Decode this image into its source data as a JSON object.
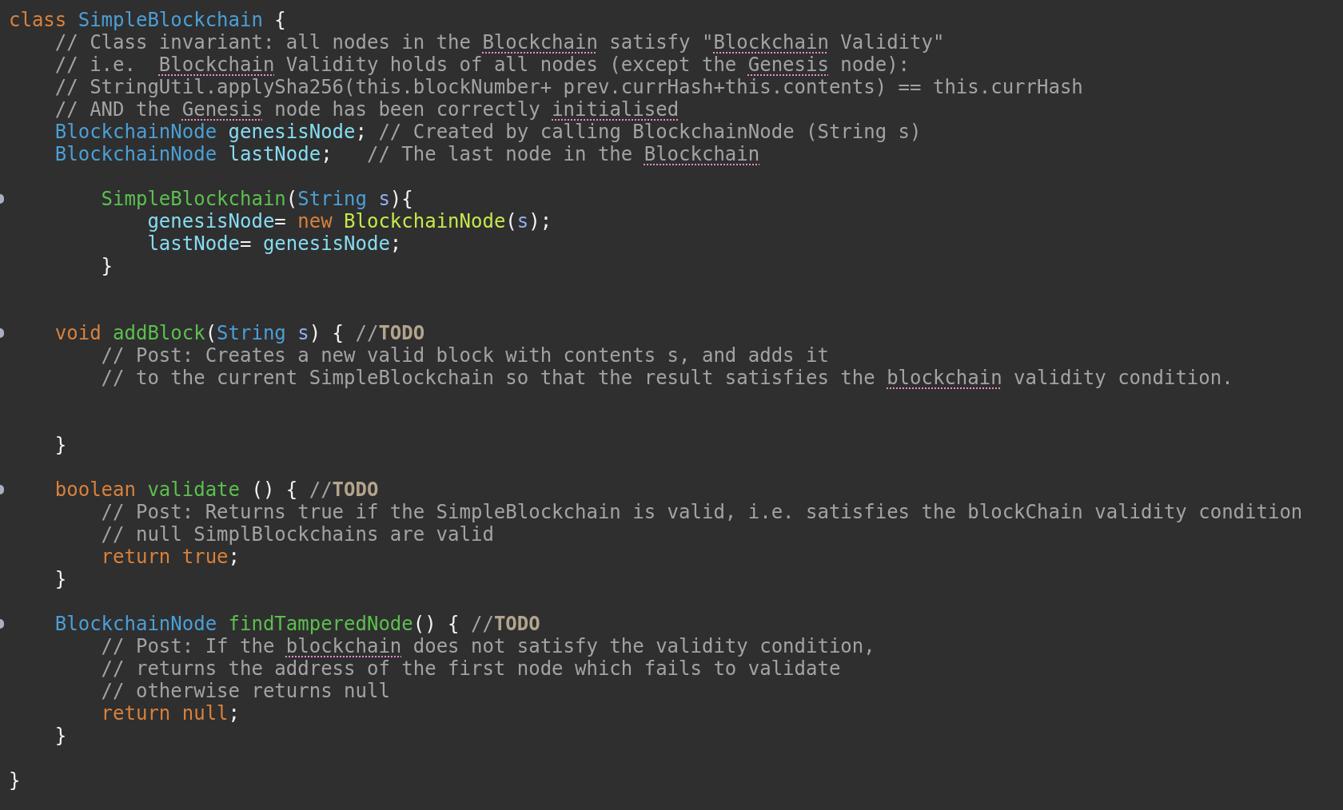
{
  "editor": {
    "lines": [
      {
        "fold": false,
        "tokens": [
          {
            "text": "class ",
            "kind": "keyword"
          },
          {
            "text": "SimpleBlockchain",
            "kind": "type"
          },
          {
            "text": " {",
            "kind": "plain"
          }
        ]
      },
      {
        "fold": false,
        "tokens": [
          {
            "text": "    // Class invariant: all nodes in the ",
            "kind": "comment"
          },
          {
            "text": "Blockchain",
            "kind": "flagged"
          },
          {
            "text": " satisfy \"",
            "kind": "comment"
          },
          {
            "text": "Blockchain",
            "kind": "flagged"
          },
          {
            "text": " Validity\"",
            "kind": "comment"
          }
        ]
      },
      {
        "fold": false,
        "tokens": [
          {
            "text": "    // i.e.  ",
            "kind": "comment"
          },
          {
            "text": "Blockchain",
            "kind": "flagged"
          },
          {
            "text": " Validity holds of all nodes (except the ",
            "kind": "comment"
          },
          {
            "text": "Genesis",
            "kind": "flagged"
          },
          {
            "text": " node):",
            "kind": "comment"
          }
        ]
      },
      {
        "fold": false,
        "tokens": [
          {
            "text": "    // StringUtil.applySha256(this.blockNumber+ prev.currHash+this.contents) == this.currHash",
            "kind": "comment"
          }
        ]
      },
      {
        "fold": false,
        "tokens": [
          {
            "text": "    // AND the ",
            "kind": "comment"
          },
          {
            "text": "Genesis",
            "kind": "flagged"
          },
          {
            "text": " node has been correctly ",
            "kind": "comment"
          },
          {
            "text": "initialised",
            "kind": "flagged"
          }
        ]
      },
      {
        "fold": false,
        "tokens": [
          {
            "text": "    BlockchainNode ",
            "kind": "type"
          },
          {
            "text": "genesisNode",
            "kind": "field"
          },
          {
            "text": "; ",
            "kind": "plain"
          },
          {
            "text": "// Created by calling BlockchainNode (String s)",
            "kind": "comment"
          }
        ]
      },
      {
        "fold": false,
        "tokens": [
          {
            "text": "    BlockchainNode ",
            "kind": "type"
          },
          {
            "text": "lastNode",
            "kind": "field"
          },
          {
            "text": ";   ",
            "kind": "plain"
          },
          {
            "text": "// The last node in the ",
            "kind": "comment"
          },
          {
            "text": "Blockchain",
            "kind": "flagged"
          }
        ]
      },
      {
        "fold": false
      },
      {
        "fold": true,
        "tokens": [
          {
            "text": "        SimpleBlockchain",
            "kind": "func"
          },
          {
            "text": "(",
            "kind": "plain"
          },
          {
            "text": "String ",
            "kind": "type"
          },
          {
            "text": "s",
            "kind": "param"
          },
          {
            "text": "){",
            "kind": "plain"
          }
        ]
      },
      {
        "fold": false,
        "tokens": [
          {
            "text": "            genesisNode",
            "kind": "field"
          },
          {
            "text": "= ",
            "kind": "plain"
          },
          {
            "text": "new ",
            "kind": "keyword"
          },
          {
            "text": "BlockchainNode",
            "kind": "call"
          },
          {
            "text": "(",
            "kind": "plain"
          },
          {
            "text": "s",
            "kind": "param"
          },
          {
            "text": ");",
            "kind": "plain"
          }
        ]
      },
      {
        "fold": false,
        "tokens": [
          {
            "text": "            lastNode",
            "kind": "field"
          },
          {
            "text": "= ",
            "kind": "plain"
          },
          {
            "text": "genesisNode",
            "kind": "field"
          },
          {
            "text": ";",
            "kind": "plain"
          }
        ]
      },
      {
        "fold": false,
        "tokens": [
          {
            "text": "        }",
            "kind": "plain"
          }
        ]
      },
      {
        "fold": false
      },
      {
        "fold": false
      },
      {
        "fold": true,
        "tokens": [
          {
            "text": "    void ",
            "kind": "keyword"
          },
          {
            "text": "addBlock",
            "kind": "func"
          },
          {
            "text": "(",
            "kind": "plain"
          },
          {
            "text": "String ",
            "kind": "type"
          },
          {
            "text": "s",
            "kind": "param"
          },
          {
            "text": ") { ",
            "kind": "plain"
          },
          {
            "text": "//",
            "kind": "comment"
          },
          {
            "text": "TODO",
            "kind": "todo"
          }
        ]
      },
      {
        "fold": false,
        "tokens": [
          {
            "text": "        // Post: Creates a new valid block with contents s, and adds it",
            "kind": "comment"
          }
        ]
      },
      {
        "fold": false,
        "tokens": [
          {
            "text": "        // to the current SimpleBlockchain so that the result satisfies the ",
            "kind": "comment"
          },
          {
            "text": "blockchain",
            "kind": "flagged"
          },
          {
            "text": " validity condition.",
            "kind": "comment"
          }
        ]
      },
      {
        "fold": false
      },
      {
        "fold": false
      },
      {
        "fold": false,
        "tokens": [
          {
            "text": "    }",
            "kind": "plain"
          }
        ]
      },
      {
        "fold": false
      },
      {
        "fold": true,
        "tokens": [
          {
            "text": "    boolean ",
            "kind": "keyword"
          },
          {
            "text": "validate ",
            "kind": "func"
          },
          {
            "text": "() { ",
            "kind": "plain"
          },
          {
            "text": "//",
            "kind": "comment"
          },
          {
            "text": "TODO",
            "kind": "todo"
          }
        ]
      },
      {
        "fold": false,
        "tokens": [
          {
            "text": "        // Post: Returns true if the SimpleBlockchain is valid, i.e. satisfies the blockChain validity condition",
            "kind": "comment"
          }
        ]
      },
      {
        "fold": false,
        "tokens": [
          {
            "text": "        // null SimplBlockchains are valid",
            "kind": "comment"
          }
        ]
      },
      {
        "fold": false,
        "tokens": [
          {
            "text": "        return true",
            "kind": "keyword"
          },
          {
            "text": ";",
            "kind": "plain"
          }
        ]
      },
      {
        "fold": false,
        "tokens": [
          {
            "text": "    }",
            "kind": "plain"
          }
        ]
      },
      {
        "fold": false
      },
      {
        "fold": true,
        "tokens": [
          {
            "text": "    BlockchainNode ",
            "kind": "type"
          },
          {
            "text": "findTamperedNode",
            "kind": "func"
          },
          {
            "text": "() { ",
            "kind": "plain"
          },
          {
            "text": "//",
            "kind": "comment"
          },
          {
            "text": "TODO",
            "kind": "todo"
          }
        ]
      },
      {
        "fold": false,
        "tokens": [
          {
            "text": "        // Post: If the ",
            "kind": "comment"
          },
          {
            "text": "blockchain",
            "kind": "flagged"
          },
          {
            "text": " does not satisfy the validity condition,",
            "kind": "comment"
          }
        ]
      },
      {
        "fold": false,
        "tokens": [
          {
            "text": "        // returns the address of the first node which fails to validate",
            "kind": "comment"
          }
        ]
      },
      {
        "fold": false,
        "tokens": [
          {
            "text": "        // otherwise returns null",
            "kind": "comment"
          }
        ]
      },
      {
        "fold": false,
        "tokens": [
          {
            "text": "        return null",
            "kind": "keyword"
          },
          {
            "text": ";",
            "kind": "plain"
          }
        ]
      },
      {
        "fold": false,
        "tokens": [
          {
            "text": "    }",
            "kind": "plain"
          }
        ]
      },
      {
        "fold": false
      },
      {
        "fold": false,
        "tokens": [
          {
            "text": "}",
            "kind": "plain"
          }
        ]
      }
    ]
  }
}
